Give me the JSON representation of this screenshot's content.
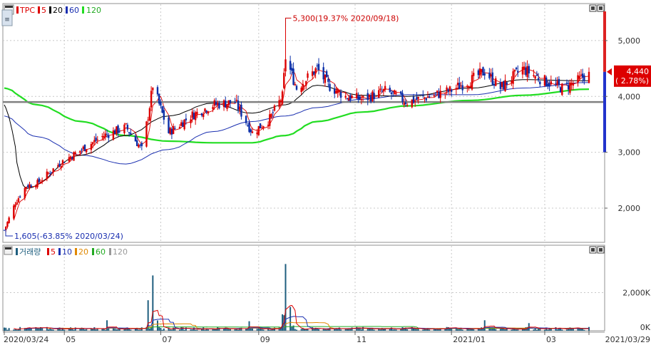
{
  "price_panel": {
    "legend": {
      "symbol": "TPC",
      "ma_labels": [
        "5",
        "20",
        "60",
        "120"
      ]
    },
    "y_ticks": [
      "5,000",
      "4,000",
      "3,000",
      "2,000"
    ],
    "last_price": "4,440",
    "last_change": "( 2.78%)",
    "max_annotation": "5,300(19.37% 2020/09/18)",
    "min_annotation": "1,605(-63.85% 2020/03/24)",
    "side_icon": "calendar-icon"
  },
  "volume_panel": {
    "legend": {
      "title": "거래량",
      "ma_labels": [
        "5",
        "10",
        "20",
        "60",
        "120"
      ]
    },
    "y_ticks": [
      "2,000K",
      "0K"
    ]
  },
  "x_axis": {
    "labels": [
      "2020/03/24",
      "05",
      "07",
      "09",
      "11",
      "2021/01",
      "03",
      "2021/03/29"
    ]
  },
  "colors": {
    "up": "#dd0000",
    "down": "#0a2ea8",
    "ma5": "#dd0000",
    "ma20": "#000000",
    "ma60": "#1a2fb0",
    "ma120": "#22dd22",
    "vol_ma10": "#1a2fb0",
    "vol_ma20": "#e08800",
    "vol_ma60": "#22aa22",
    "vol_ma120": "#999999",
    "volume_bar": "#1f5f7f",
    "ref_line": "#808080",
    "grid": "#c8c8c8",
    "price_bar_top": "#dd2222",
    "price_bar_bottom": "#2233cc"
  },
  "chart_data": {
    "type": "candlestick",
    "x_range": [
      "2020/03/24",
      "2021/03/29"
    ],
    "ylim": [
      1400,
      5650
    ],
    "grid": true,
    "ohlc_anchors": [
      {
        "date": "2020/03/24",
        "close": 1605,
        "note": "low"
      },
      {
        "date": "2020/03/31",
        "close": 2100
      },
      {
        "date": "2020/04/07",
        "close": 2400
      },
      {
        "date": "2020/04/14",
        "close": 2450
      },
      {
        "date": "2020/04/28",
        "close": 2800
      },
      {
        "date": "2020/05/12",
        "close": 3050
      },
      {
        "date": "2020/05/26",
        "close": 3300
      },
      {
        "date": "2020/06/09",
        "close": 3450
      },
      {
        "date": "2020/06/19",
        "close": 3050
      },
      {
        "date": "2020/06/23",
        "close": 3650
      },
      {
        "date": "2020/06/26",
        "close": 4200
      },
      {
        "date": "2020/07/06",
        "close": 3350
      },
      {
        "date": "2020/07/20",
        "close": 3650
      },
      {
        "date": "2020/08/03",
        "close": 3850
      },
      {
        "date": "2020/08/17",
        "close": 3900
      },
      {
        "date": "2020/08/28",
        "close": 3350
      },
      {
        "date": "2020/09/08",
        "close": 3600
      },
      {
        "date": "2020/09/16",
        "close": 4000
      },
      {
        "date": "2020/09/18",
        "close": 4700,
        "high": 5300,
        "note": "high"
      },
      {
        "date": "2020/09/25",
        "close": 4150
      },
      {
        "date": "2020/10/08",
        "close": 4500
      },
      {
        "date": "2020/10/15",
        "close": 4200
      },
      {
        "date": "2020/10/26",
        "close": 4000
      },
      {
        "date": "2020/11/06",
        "close": 3950
      },
      {
        "date": "2020/11/20",
        "close": 4100
      },
      {
        "date": "2020/12/04",
        "close": 3900
      },
      {
        "date": "2020/12/18",
        "close": 4000
      },
      {
        "date": "2020/12/31",
        "close": 4100
      },
      {
        "date": "2021/01/14",
        "close": 4300
      },
      {
        "date": "2021/01/22",
        "close": 4450
      },
      {
        "date": "2021/02/01",
        "close": 4150
      },
      {
        "date": "2021/02/15",
        "close": 4500
      },
      {
        "date": "2021/02/24",
        "close": 4350
      },
      {
        "date": "2021/03/03",
        "close": 4250
      },
      {
        "date": "2021/03/12",
        "close": 4150
      },
      {
        "date": "2021/03/22",
        "close": 4280
      },
      {
        "date": "2021/03/29",
        "close": 4440,
        "note": "last"
      }
    ],
    "moving_averages": {
      "ma120": [
        {
          "date": "2020/03/24",
          "value": 4150
        },
        {
          "date": "2020/04/14",
          "value": 3850
        },
        {
          "date": "2020/05/12",
          "value": 3550
        },
        {
          "date": "2020/06/09",
          "value": 3300
        },
        {
          "date": "2020/07/06",
          "value": 3200
        },
        {
          "date": "2020/08/03",
          "value": 3170
        },
        {
          "date": "2020/08/28",
          "value": 3170
        },
        {
          "date": "2020/09/18",
          "value": 3300
        },
        {
          "date": "2020/10/08",
          "value": 3550
        },
        {
          "date": "2020/11/06",
          "value": 3720
        },
        {
          "date": "2020/12/04",
          "value": 3830
        },
        {
          "date": "2021/01/14",
          "value": 3930
        },
        {
          "date": "2021/02/15",
          "value": 4020
        },
        {
          "date": "2021/03/29",
          "value": 4130
        }
      ],
      "ma60": [
        {
          "date": "2020/03/24",
          "value": 3650
        },
        {
          "date": "2020/04/14",
          "value": 3280
        },
        {
          "date": "2020/05/12",
          "value": 2950
        },
        {
          "date": "2020/06/09",
          "value": 2790
        },
        {
          "date": "2020/07/06",
          "value": 3050
        },
        {
          "date": "2020/08/03",
          "value": 3370
        },
        {
          "date": "2020/08/28",
          "value": 3550
        },
        {
          "date": "2020/09/18",
          "value": 3650
        },
        {
          "date": "2020/10/08",
          "value": 3800
        },
        {
          "date": "2020/11/06",
          "value": 3950
        },
        {
          "date": "2020/12/04",
          "value": 4030
        },
        {
          "date": "2021/01/14",
          "value": 4030
        },
        {
          "date": "2021/02/15",
          "value": 4150
        },
        {
          "date": "2021/03/29",
          "value": 4250
        }
      ],
      "ma20": [
        {
          "date": "2020/03/24",
          "value": 3850
        },
        {
          "date": "2020/04/07",
          "value": 2350
        },
        {
          "date": "2020/05/12",
          "value": 2950
        },
        {
          "date": "2020/06/09",
          "value": 3300
        },
        {
          "date": "2020/07/06",
          "value": 3650
        },
        {
          "date": "2020/08/03",
          "value": 3880
        },
        {
          "date": "2020/08/28",
          "value": 3700
        },
        {
          "date": "2020/09/18",
          "value": 3850
        },
        {
          "date": "2020/10/08",
          "value": 4200
        },
        {
          "date": "2020/11/06",
          "value": 4020
        },
        {
          "date": "2020/12/04",
          "value": 4000
        },
        {
          "date": "2021/01/14",
          "value": 4150
        },
        {
          "date": "2021/02/15",
          "value": 4300
        },
        {
          "date": "2021/03/29",
          "value": 4280
        }
      ]
    },
    "reference_line": 3900,
    "volume_ylim": [
      0,
      3700000
    ],
    "volume_spikes": [
      {
        "date": "2020/06/23",
        "value": 1600000
      },
      {
        "date": "2020/06/26",
        "value": 2900000
      },
      {
        "date": "2020/09/18",
        "value": 3500000
      },
      {
        "date": "2020/09/21",
        "value": 1250000
      },
      {
        "date": "2020/05/28",
        "value": 550000
      },
      {
        "date": "2020/08/26",
        "value": 500000
      },
      {
        "date": "2021/01/22",
        "value": 550000
      },
      {
        "date": "2021/02/19",
        "value": 400000
      }
    ],
    "volume_base": 110000,
    "volume_ma5_peaks": [
      {
        "date": "2020/06/29",
        "value": 950000
      },
      {
        "date": "2020/09/22",
        "value": 1300000
      }
    ]
  }
}
